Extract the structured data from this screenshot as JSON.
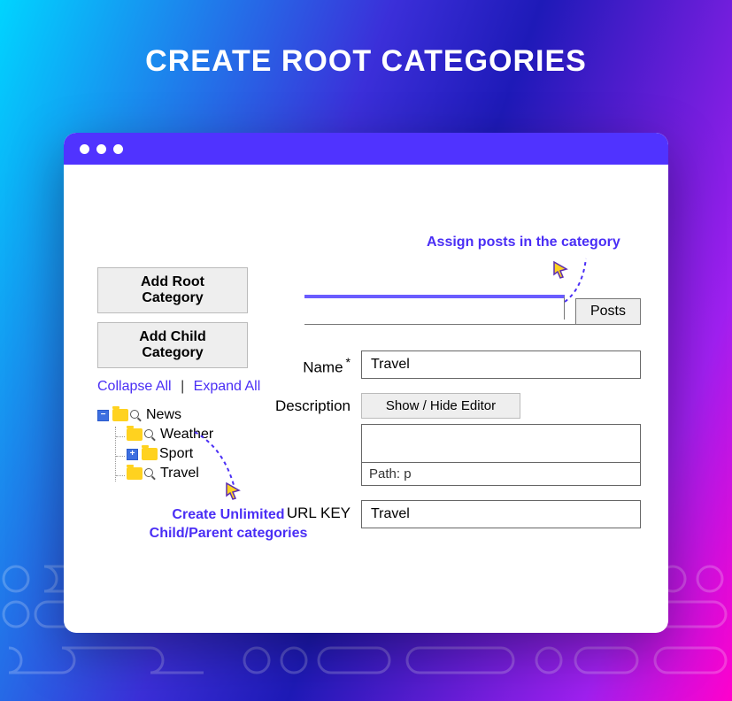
{
  "page": {
    "title": "CREATE ROOT CATEGORIES"
  },
  "annotations": {
    "assign_posts": "Assign posts in the category",
    "create_unlimited_l1": "Create Unlimited",
    "create_unlimited_l2": "Child/Parent categories"
  },
  "sidebar": {
    "add_root": "Add Root Category",
    "add_child": "Add Child Category",
    "collapse": "Collapse All",
    "expand": "Expand All",
    "tree": {
      "root": {
        "label": "News"
      },
      "children": [
        {
          "label": "Weather"
        },
        {
          "label": "Sport"
        },
        {
          "label": "Travel"
        }
      ]
    }
  },
  "tabs": {
    "posts": "Posts"
  },
  "form": {
    "name_label": "Name",
    "name_value": "Travel",
    "required_mark": "*",
    "description_label": "Description",
    "toggle_editor": "Show / Hide Editor",
    "editor_path": "Path: p",
    "url_key_label": "URL KEY",
    "url_key_value": "Travel"
  }
}
